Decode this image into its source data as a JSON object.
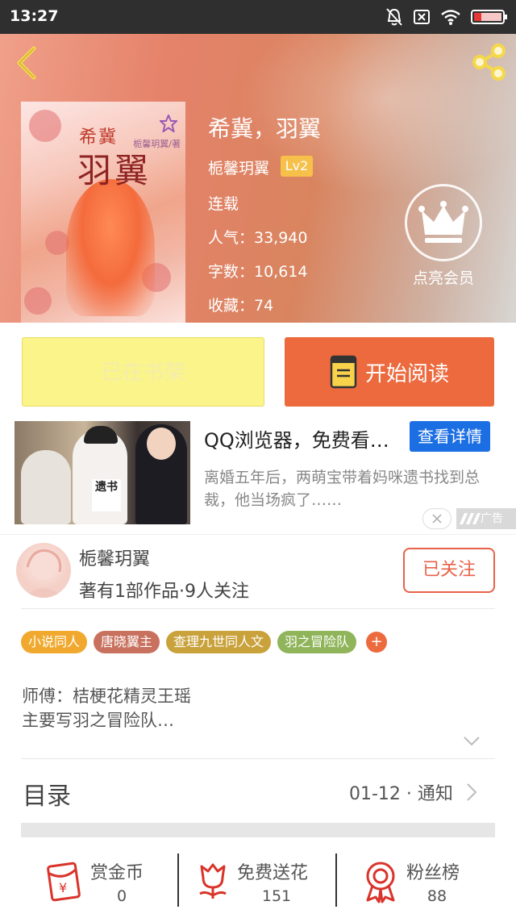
{
  "status_bar": {
    "time": "13:27"
  },
  "book": {
    "title": "希冀，羽翼",
    "cover_title_small": "希冀",
    "cover_title_large": "羽翼",
    "cover_author": "栀馨玥翼/著",
    "author": "栀馨玥翼",
    "level": "Lv2",
    "status": "连载",
    "popularity": "人气：33,940",
    "word_count": "字数：10,614",
    "favorites": "收藏：74"
  },
  "vip": {
    "label": "点亮会员"
  },
  "actions": {
    "shelf_label": "已在书架",
    "read_label": "开始阅读"
  },
  "ad": {
    "title": "QQ浏览器，免费看…",
    "cta": "查看详情",
    "description": "离婚五年后，两萌宝带着妈咪遗书找到总裁，他当场疯了……",
    "tag": "广告",
    "image_sign": "遗书"
  },
  "author_card": {
    "name": "栀馨玥翼",
    "stats": "著有1部作品·9人关注",
    "follow_label": "已关注"
  },
  "tags": [
    {
      "label": "小说同人",
      "color": "#f0a92e"
    },
    {
      "label": "唐晓翼主",
      "color": "#c8715e"
    },
    {
      "label": "查理九世同人文",
      "color": "#c9a23c"
    },
    {
      "label": "羽之冒险队",
      "color": "#8fb45a"
    }
  ],
  "tag_plus": "+",
  "intro": {
    "line1": "师傅：桔梗花精灵王瑶",
    "line2": "主要写羽之冒险队…"
  },
  "catalog": {
    "title": "目录",
    "meta": "01-12 · 通知"
  },
  "stats": [
    {
      "label": "赏金币",
      "value": "0",
      "icon": "red-envelope-yen-icon"
    },
    {
      "label": "免费送花",
      "value": "151",
      "icon": "flower-icon"
    },
    {
      "label": "粉丝榜",
      "value": "88",
      "icon": "medal-icon"
    }
  ],
  "colors": {
    "accent": "#ec6a3e",
    "follow": "#e8624a",
    "shelf": "#fbf48a",
    "ad_button": "#1c6fe3"
  }
}
